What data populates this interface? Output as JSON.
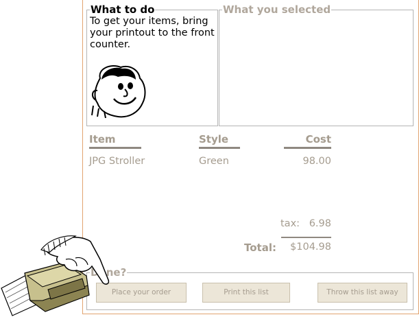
{
  "todo": {
    "heading": "What to do",
    "text": "To get your items, bring your printout to the front counter."
  },
  "selected": {
    "heading": "What you selected"
  },
  "table": {
    "headers": {
      "item": "Item",
      "style": "Style",
      "cost": "Cost"
    },
    "rows": [
      {
        "item": "JPG Stroller",
        "style": "Green",
        "cost": "98.00"
      }
    ],
    "tax_label": "tax:",
    "tax_value": "6.98",
    "total_label": "Total:",
    "total_value": "$104.98"
  },
  "done": {
    "heading": "Done?",
    "place_order": "Place your order",
    "print_list": "Print this list",
    "throw_away": "Throw this list away"
  },
  "colors": {
    "frame_border": "#e2a36f",
    "muted_text": "#a59c8f",
    "button_bg": "#ece6d8"
  }
}
